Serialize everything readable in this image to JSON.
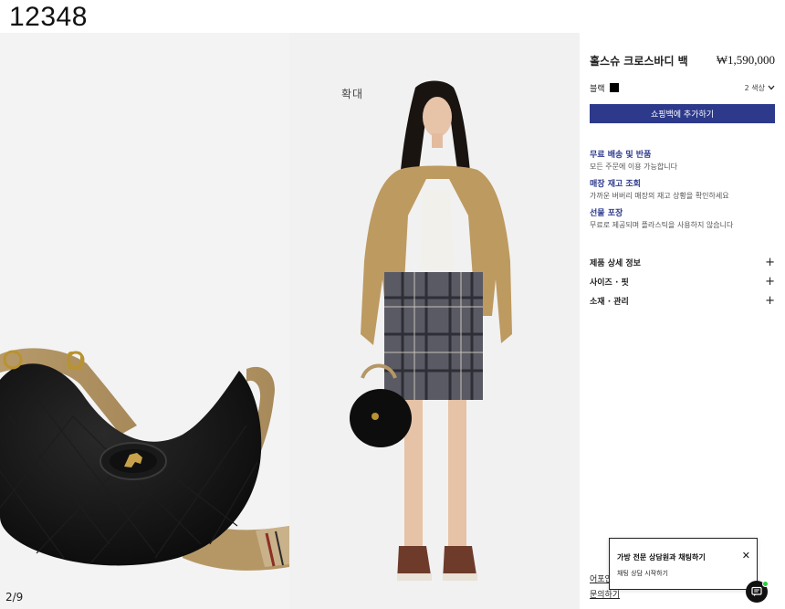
{
  "header": {
    "product_number": "12348"
  },
  "gallery": {
    "zoom_label": "확대",
    "page_counter": "2/9"
  },
  "product": {
    "name": "홀스슈 크로스바디 백",
    "price": "₩1,590,000",
    "color_label": "블랙",
    "color_count": "2 색상",
    "add_to_bag": "쇼핑백에 추가하기"
  },
  "services": [
    {
      "title": "무료 배송 및 반품",
      "desc": "모든 주문에 이용 가능합니다"
    },
    {
      "title": "매장 재고 조회",
      "desc": "가까운 버버리 매장의 재고 상황을 확인하세요"
    },
    {
      "title": "선물 포장",
      "desc": "무료로 제공되며 플라스틱을 사용하지 않습니다"
    }
  ],
  "accordion": [
    {
      "label": "제품 상세 정보"
    },
    {
      "label": "사이즈 · 핏"
    },
    {
      "label": "소재 · 관리"
    }
  ],
  "footer": {
    "link1": "어포인트먼트",
    "link2": "문의하기"
  },
  "chat": {
    "title": "가방 전문 상담원과 채팅하기",
    "subtitle": "채팅 상담 시작하기"
  }
}
